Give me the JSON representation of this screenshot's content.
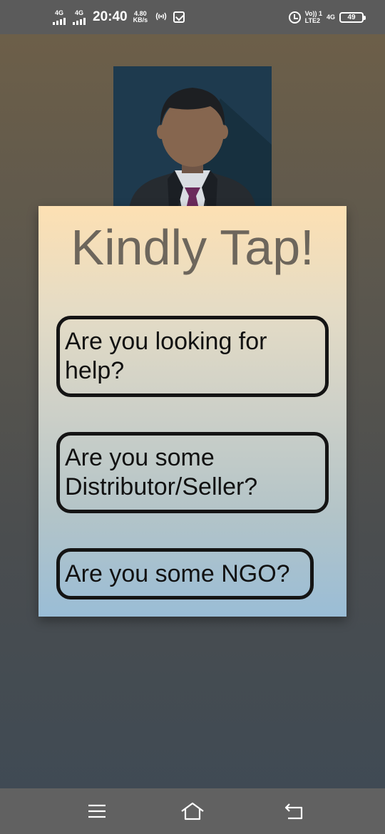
{
  "status_bar": {
    "sim1_network": "4G",
    "sim2_network": "4G",
    "time": "20:40",
    "speed_value": "4.80",
    "speed_unit": "KB/s",
    "volte_line1": "Vo)) 1",
    "volte_line2": "LTE2",
    "network_type": "4G",
    "battery_level": "49"
  },
  "main": {
    "title": "Kindly Tap!",
    "options": [
      {
        "label": "Are you looking for help?"
      },
      {
        "label": "Are you some Distributor/Seller?"
      },
      {
        "label": "Are you some NGO?"
      }
    ]
  },
  "nav_bar": {
    "icons": [
      "menu-icon",
      "home-icon",
      "back-icon"
    ]
  },
  "colors": {
    "card_top": "#fde0b3",
    "card_bottom": "#9abdd6",
    "title_text": "#6d665c",
    "button_border": "#141414",
    "avatar_background": "#1e3a4e"
  }
}
